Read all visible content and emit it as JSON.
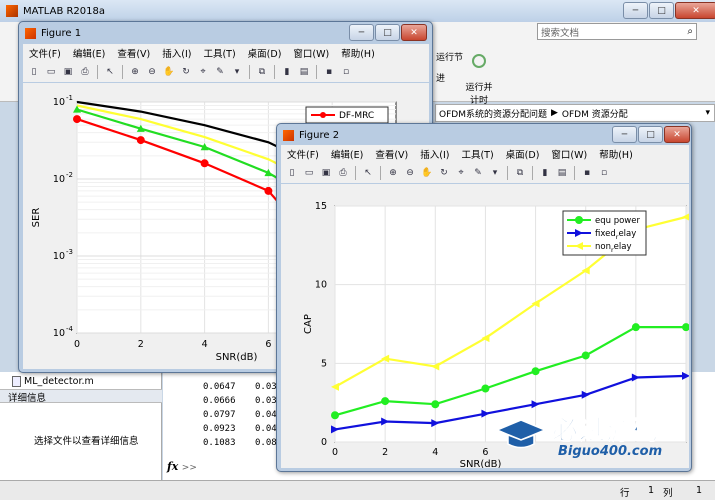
{
  "matlab": {
    "title": "MATLAB R2018a",
    "search_placeholder": "搜索文档",
    "ribbon_btn1": "运行节",
    "ribbon_btn1b": "进",
    "ribbon_btn2": "运行并\n计时",
    "breadcrumb1": "OFDM系统的资源分配问题",
    "breadcrumb2": "OFDM 资源分配",
    "file_item": "ML_detector.m",
    "details_header": "详细信息",
    "details_text": "选择文件以查看详细信息",
    "fx": "fx",
    "fx_arrow": ">>",
    "status_row": "行",
    "status_row_val": "1",
    "status_col": "列",
    "status_col_val": "1",
    "cmd_values": [
      "0.0647",
      "0.0666",
      "0.0797",
      "0.0923",
      "0.1083"
    ],
    "cmd_values2": [
      "0.03",
      "0.03",
      "0.04",
      "0.04",
      "0.08"
    ]
  },
  "menu": [
    "文件(F)",
    "编辑(E)",
    "查看(V)",
    "插入(I)",
    "工具(T)",
    "桌面(D)",
    "窗口(W)",
    "帮助(H)"
  ],
  "figure1": {
    "title": "Figure 1",
    "chart_data": {
      "type": "line",
      "yscale": "log",
      "xlabel": "SNR(dB)",
      "ylabel": "SER",
      "xlim": [
        0,
        10
      ],
      "ylim": [
        0.0001,
        0.1
      ],
      "xticks": [
        "0",
        "2",
        "4",
        "6",
        "8"
      ],
      "yticks": [
        "10^-1",
        "10^-2",
        "10^-3",
        "10^-4"
      ],
      "legend": [
        "DF-MRC"
      ],
      "series": [
        {
          "name": "",
          "color": "#000000",
          "marker": "none",
          "x": [
            0,
            2,
            4,
            6,
            8,
            10
          ],
          "y": [
            0.1,
            0.075,
            0.05,
            0.03,
            0.012,
            0.005
          ]
        },
        {
          "name": "",
          "color": "#ffff33",
          "marker": "none",
          "x": [
            0,
            2,
            4,
            6,
            8,
            10
          ],
          "y": [
            0.09,
            0.06,
            0.035,
            0.018,
            0.007,
            0.0025
          ]
        },
        {
          "name": "",
          "color": "#22dd22",
          "marker": "triangle",
          "x": [
            0,
            2,
            4,
            6,
            8,
            10
          ],
          "y": [
            0.08,
            0.045,
            0.026,
            0.012,
            0.004,
            0.0012
          ]
        },
        {
          "name": "DF-MRC",
          "color": "#ff0000",
          "marker": "circle",
          "x": [
            0,
            2,
            4,
            6,
            8,
            10
          ],
          "y": [
            0.06,
            0.032,
            0.016,
            0.007,
            0.0008,
            0.0002
          ]
        }
      ]
    }
  },
  "figure2": {
    "title": "Figure 2",
    "chart_data": {
      "type": "line",
      "xlabel": "SNR(dB)",
      "ylabel": "CAP",
      "xlim": [
        0,
        14
      ],
      "ylim": [
        0,
        15
      ],
      "xticks": [
        "0",
        "2",
        "4",
        "6"
      ],
      "yticks": [
        "0",
        "5",
        "10",
        "15"
      ],
      "series": [
        {
          "name": "equ power",
          "color": "#22ee22",
          "marker": "circle",
          "x": [
            0,
            2,
            4,
            6,
            8,
            10,
            12,
            14
          ],
          "y": [
            1.7,
            2.6,
            2.4,
            3.4,
            4.5,
            5.5,
            7.3,
            7.3
          ]
        },
        {
          "name": "fixed_relay",
          "legend_main": "fixed",
          "legend_sub": "r",
          "legend_tail": "elay",
          "color": "#1111dd",
          "marker": "triangle-right",
          "x": [
            0,
            2,
            4,
            6,
            8,
            10,
            12,
            14
          ],
          "y": [
            0.8,
            1.3,
            1.2,
            1.8,
            2.4,
            3.0,
            4.1,
            4.2
          ]
        },
        {
          "name": "non_relay",
          "legend_main": "non",
          "legend_sub": "r",
          "legend_tail": "elay",
          "color": "#ffff33",
          "marker": "triangle-left",
          "x": [
            0,
            2,
            4,
            6,
            8,
            10,
            12,
            14
          ],
          "y": [
            3.5,
            5.3,
            4.8,
            6.6,
            8.8,
            10.9,
            13.5,
            14.3
          ]
        }
      ]
    }
  },
  "watermark": {
    "text": "必过源码",
    "url": "Biguo400.com"
  }
}
